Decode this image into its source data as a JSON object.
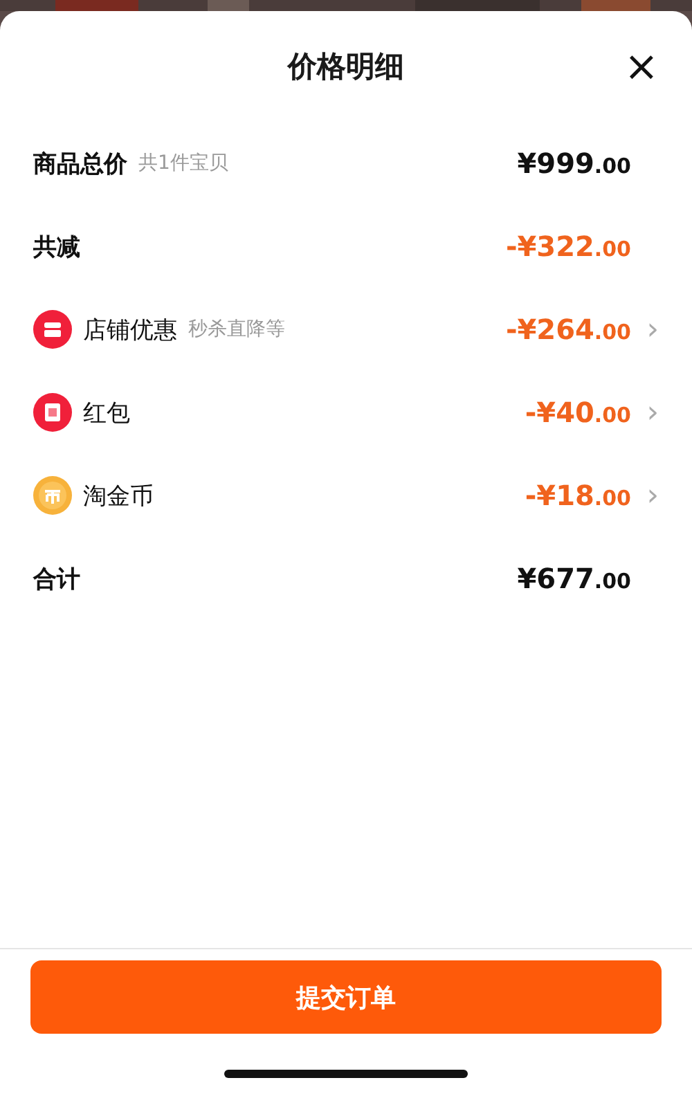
{
  "sheet": {
    "title": "价格明细",
    "close": "×"
  },
  "rows": [
    {
      "kind": "total",
      "label": "商品总价",
      "note": "共1件宝贝",
      "amount": "¥999",
      "decimals": ".00"
    },
    {
      "kind": "discount",
      "label": "共减",
      "amount": "-¥322",
      "decimals": ".00"
    },
    {
      "kind": "shop",
      "label": "店铺优惠",
      "note": "秒杀直降等",
      "amount": "-¥264",
      "decimals": ".00",
      "chevron": "›"
    },
    {
      "kind": "envelope",
      "label": "红包",
      "amount": "-¥40",
      "decimals": ".00",
      "chevron": "›"
    },
    {
      "kind": "coin",
      "label": "淘金币",
      "amount": "-¥18",
      "decimals": ".00",
      "chevron": "›"
    },
    {
      "kind": "total",
      "label": "合计",
      "amount": "¥677",
      "decimals": ".00"
    }
  ],
  "submit_button": "提交订单"
}
